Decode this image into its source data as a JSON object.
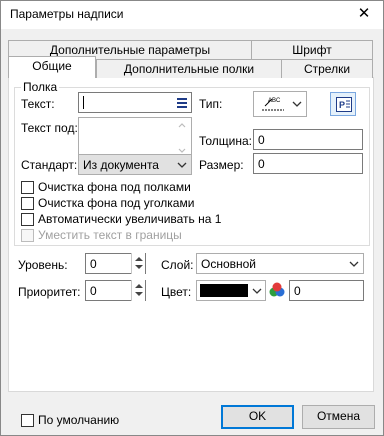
{
  "window": {
    "title": "Параметры надписи",
    "close_glyph": "✕"
  },
  "tabs": {
    "row1": [
      "Дополнительные параметры",
      "Шрифт"
    ],
    "row2": [
      "Общие",
      "Дополнительные полки",
      "Стрелки"
    ],
    "active": "Общие"
  },
  "shelf": {
    "group_label": "Полка",
    "text_label": "Текст:",
    "text_value": "",
    "subtext_label": "Текст под:",
    "subtext_value": "",
    "standard_label": "Стандарт:",
    "standard_value": "Из документа",
    "type_label": "Тип:",
    "type_icon": "underline-text-icon",
    "thickness_label": "Толщина:",
    "thickness_value": "0",
    "size_label": "Размер:",
    "size_value": "0",
    "checkboxes": [
      {
        "label": "Очистка фона под полками",
        "checked": false,
        "enabled": true
      },
      {
        "label": "Очистка фона под уголками",
        "checked": false,
        "enabled": true
      },
      {
        "label": "Автоматически увеличивать на 1",
        "checked": false,
        "enabled": true
      },
      {
        "label": "Уместить текст в границы",
        "checked": false,
        "enabled": false
      }
    ]
  },
  "lower": {
    "level_label": "Уровень:",
    "level_value": "0",
    "layer_label": "Слой:",
    "layer_value": "Основной",
    "priority_label": "Приоритет:",
    "priority_value": "0",
    "color_label": "Цвет:",
    "color_swatch": "#000000",
    "color_value": "0"
  },
  "footer": {
    "default_label": "По умолчанию",
    "ok_label": "OK",
    "cancel_label": "Отмена"
  },
  "colors": {
    "accent": "#0078d7",
    "disabled_text": "#a0a0a0"
  }
}
